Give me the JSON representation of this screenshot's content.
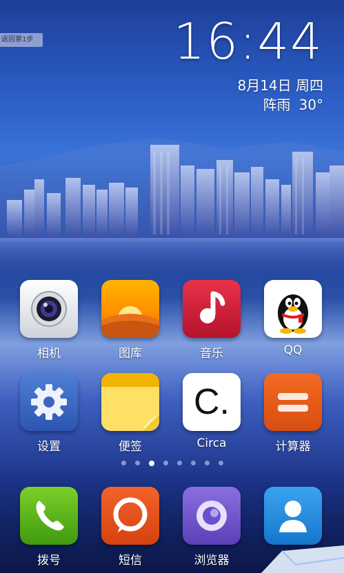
{
  "overlay": {
    "back_label": "返回第1步"
  },
  "lockclock": {
    "time": "16:44",
    "date": "8月14日 周四",
    "weather": "阵雨",
    "temp": "30°"
  },
  "apps": [
    {
      "label": "相机",
      "icon": "camera-icon"
    },
    {
      "label": "图库",
      "icon": "gallery-icon"
    },
    {
      "label": "音乐",
      "icon": "music-icon"
    },
    {
      "label": "QQ",
      "icon": "qq-penguin-icon"
    },
    {
      "label": "设置",
      "icon": "gear-icon"
    },
    {
      "label": "便签",
      "icon": "notes-icon"
    },
    {
      "label": "Circa",
      "icon": "circa-icon",
      "glyph": "C."
    },
    {
      "label": "计算器",
      "icon": "calculator-icon"
    }
  ],
  "dock": [
    {
      "label": "拨号",
      "icon": "phone-icon"
    },
    {
      "label": "短信",
      "icon": "message-icon"
    },
    {
      "label": "浏览器",
      "icon": "browser-icon"
    },
    {
      "label": "",
      "icon": "contacts-icon"
    }
  ],
  "pager": {
    "count": 8,
    "active": 3
  }
}
